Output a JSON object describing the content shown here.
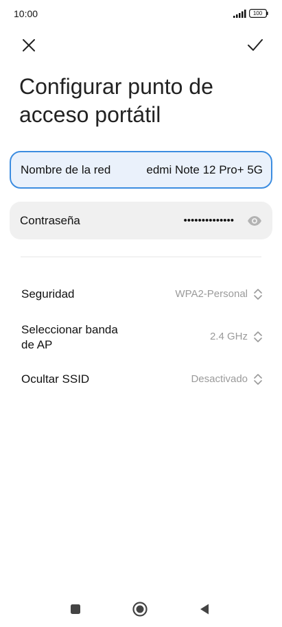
{
  "status_bar": {
    "time": "10:00",
    "battery": "100"
  },
  "header": {
    "close_icon": "close-icon",
    "confirm_icon": "check-icon",
    "title": "Configurar punto de acceso portátil"
  },
  "form": {
    "ssid": {
      "label": "Nombre de la red",
      "value": "edmi Note 12 Pro+ 5G"
    },
    "password": {
      "label": "Contraseña",
      "value": "••••••••••••••",
      "icon": "eye-icon"
    }
  },
  "settings": {
    "security": {
      "label": "Seguridad",
      "value": "WPA2-Personal"
    },
    "band": {
      "label": "Seleccionar banda de AP",
      "value": "2.4 GHz"
    },
    "hide_ssid": {
      "label": "Ocultar SSID",
      "value": "Desactivado"
    }
  },
  "colors": {
    "accent": "#3b8ce0",
    "field_bg": "#f0f0f0",
    "active_field_bg": "#eaf1fb",
    "secondary_text": "#9a9a9a"
  },
  "nav_bar": {
    "recents_icon": "square-icon",
    "home_icon": "circle-icon",
    "back_icon": "triangle-back-icon"
  }
}
